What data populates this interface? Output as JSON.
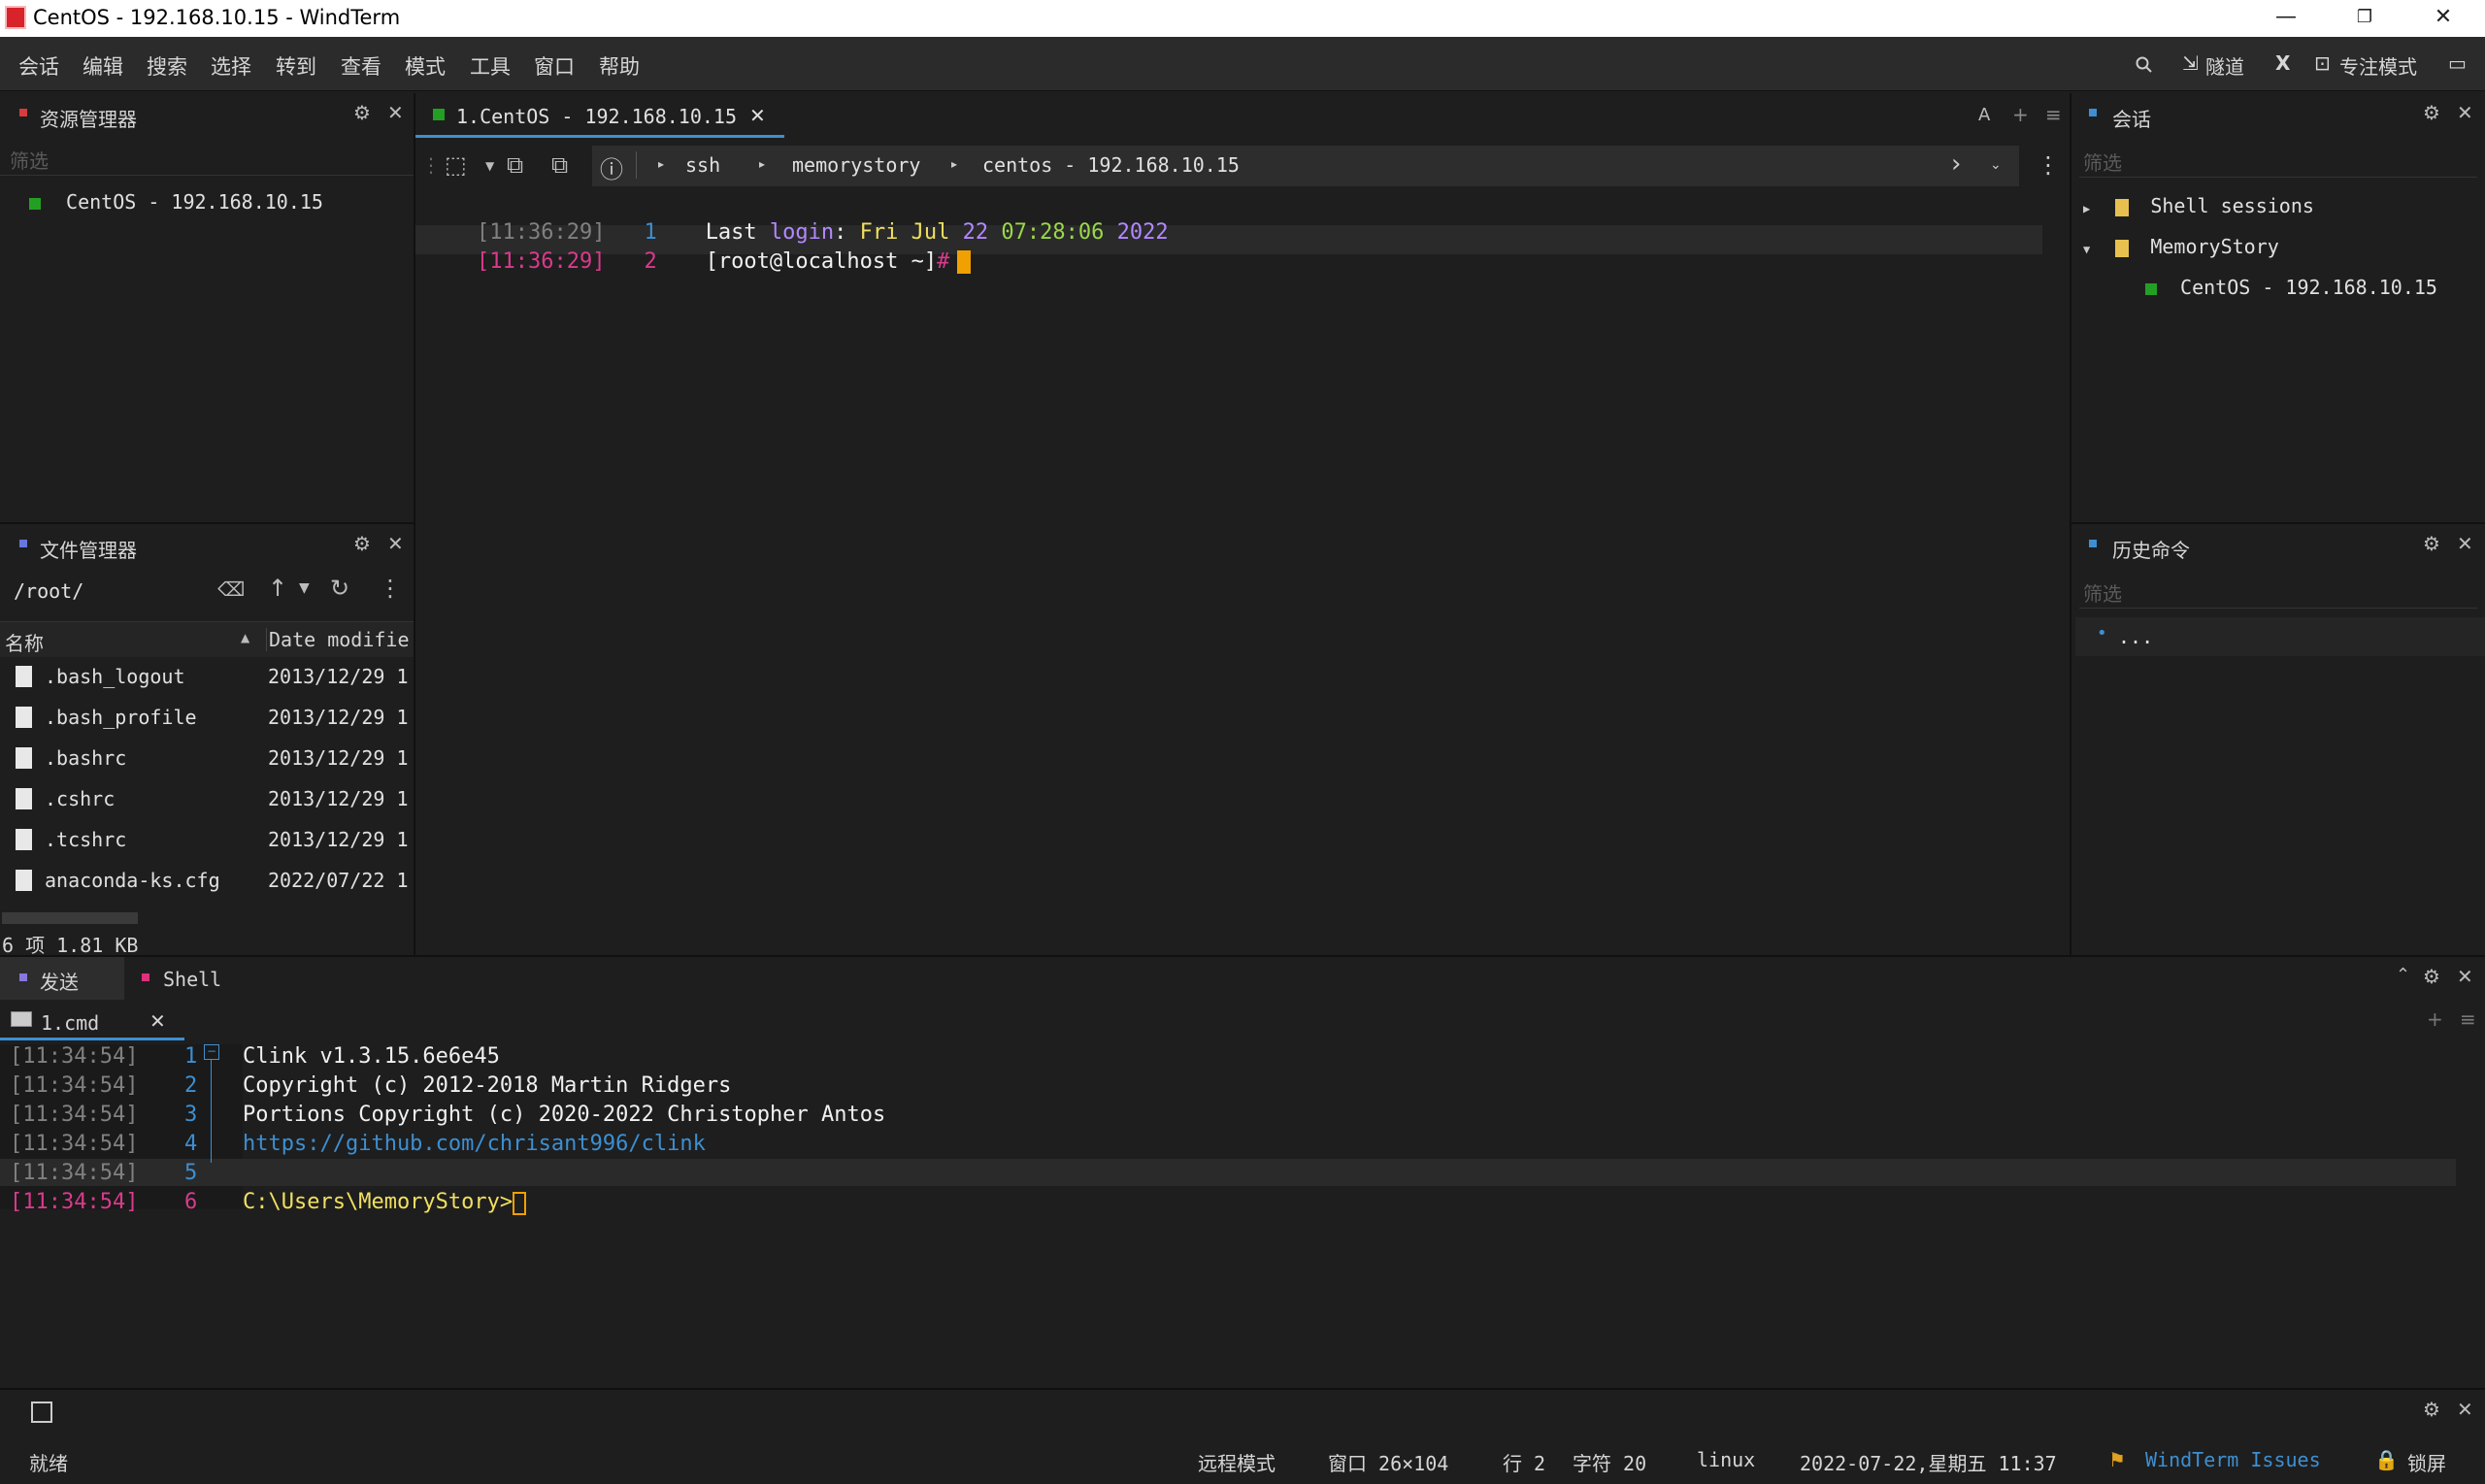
{
  "window": {
    "title": "CentOS - 192.168.10.15 - WindTerm",
    "minimize": "—",
    "restore": "❐",
    "close": "✕"
  },
  "menu": [
    "会话",
    "编辑",
    "搜索",
    "选择",
    "转到",
    "查看",
    "模式",
    "工具",
    "窗口",
    "帮助"
  ],
  "toolbar": {
    "search_icon": "search-icon",
    "tunnel_label": "隧道",
    "x_label": "X",
    "focus_label": "专注模式"
  },
  "resource_manager": {
    "title": "资源管理器",
    "filter_placeholder": "筛选",
    "items": [
      {
        "label": "CentOS - 192.168.10.15"
      }
    ]
  },
  "file_manager": {
    "title": "文件管理器",
    "path": "/root/",
    "columns": {
      "name": "名称",
      "date": "Date modifie"
    },
    "files": [
      {
        "name": ".bash_logout",
        "date": "2013/12/29 1"
      },
      {
        "name": ".bash_profile",
        "date": "2013/12/29 1"
      },
      {
        "name": ".bashrc",
        "date": "2013/12/29 1"
      },
      {
        "name": ".cshrc",
        "date": "2013/12/29 1"
      },
      {
        "name": ".tcshrc",
        "date": "2013/12/29 1"
      },
      {
        "name": "anaconda-ks.cfg",
        "date": "2022/07/22 1"
      }
    ],
    "summary": "6 项 1.81 KB"
  },
  "terminal": {
    "tab_label": "1.CentOS - 192.168.10.15",
    "tab_right_a": "A",
    "breadcrumb": [
      "ssh",
      "memorystory",
      "centos - 192.168.10.15"
    ],
    "lines": [
      {
        "ts": "[11:36:29]",
        "no": "1",
        "parts": [
          "Last ",
          "login",
          ": ",
          "Fri",
          " ",
          "Jul",
          " ",
          "22",
          " ",
          "07:28:06",
          " ",
          "2022"
        ]
      },
      {
        "ts": "[11:36:29]",
        "no": "2",
        "prompt": "[root@localhost ~]",
        "hash": "#"
      }
    ]
  },
  "sessions": {
    "title": "会话",
    "filter_placeholder": "筛选",
    "items": [
      {
        "label": "Shell sessions",
        "arrow": "▶"
      },
      {
        "label": "MemoryStory",
        "arrow": "▼"
      },
      {
        "label": "CentOS - 192.168.10.15"
      }
    ]
  },
  "history": {
    "title": "历史命令",
    "filter_placeholder": "筛选",
    "items": [
      "..."
    ]
  },
  "bottom": {
    "tabs": [
      "发送",
      "Shell"
    ],
    "subtab": "1.cmd",
    "lines": [
      {
        "ts": "[11:34:54]",
        "no": "1",
        "text": "Clink v1.3.15.6e6e45"
      },
      {
        "ts": "[11:34:54]",
        "no": "2",
        "text": "Copyright (c) 2012-2018 Martin Ridgers"
      },
      {
        "ts": "[11:34:54]",
        "no": "3",
        "text": "Portions Copyright (c) 2020-2022 Christopher Antos"
      },
      {
        "ts": "[11:34:54]",
        "no": "4",
        "text": "https://github.com/chrisant996/clink"
      },
      {
        "ts": "[11:34:54]",
        "no": "5",
        "text": ""
      },
      {
        "ts": "[11:34:54]",
        "no": "6",
        "text": "C:\\Users\\MemoryStory>"
      }
    ]
  },
  "status": {
    "ready": "就绪",
    "mode": "远程模式",
    "window_size": "窗口 26×104",
    "row": "行 2",
    "col": "字符 20",
    "os": "linux",
    "datetime": "2022-07-22,星期五 11:37",
    "issues": "WindTerm Issues",
    "lock": "锁屏"
  },
  "colors": {
    "accent": "#3d8fd1",
    "cursor": "#f0a000",
    "prompt_pink": "#d83b8c",
    "green_session": "#23a023"
  }
}
